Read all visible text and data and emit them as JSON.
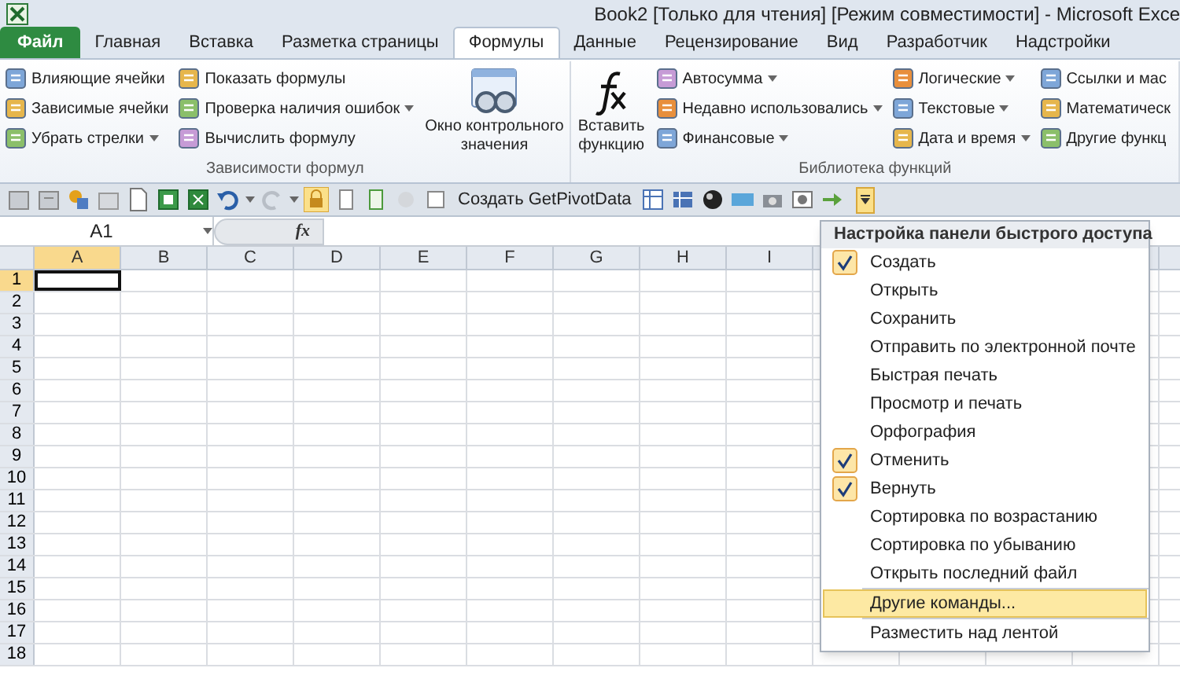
{
  "window": {
    "title": "Book2  [Только для чтения]  [Режим совместимости]  -  Microsoft Exce"
  },
  "tabs": [
    {
      "label": "Файл",
      "kind": "file",
      "selected": false
    },
    {
      "label": "Главная",
      "kind": "tab",
      "selected": false
    },
    {
      "label": "Вставка",
      "kind": "tab",
      "selected": false
    },
    {
      "label": "Разметка страницы",
      "kind": "tab",
      "selected": false
    },
    {
      "label": "Формулы",
      "kind": "tab",
      "selected": true
    },
    {
      "label": "Данные",
      "kind": "tab",
      "selected": false
    },
    {
      "label": "Рецензирование",
      "kind": "tab",
      "selected": false
    },
    {
      "label": "Вид",
      "kind": "tab",
      "selected": false
    },
    {
      "label": "Разработчик",
      "kind": "tab",
      "selected": false
    },
    {
      "label": "Надстройки",
      "kind": "tab",
      "selected": false
    }
  ],
  "ribbon": {
    "groups": [
      {
        "label": "Зависимости формул",
        "columns": [
          {
            "kind": "small",
            "items": [
              {
                "label": "Влияющие ячейки",
                "dropdown": false
              },
              {
                "label": "Зависимые ячейки",
                "dropdown": false
              },
              {
                "label": "Убрать стрелки",
                "dropdown": true
              }
            ]
          },
          {
            "kind": "small",
            "items": [
              {
                "label": "Показать формулы",
                "dropdown": false
              },
              {
                "label": "Проверка наличия ошибок",
                "dropdown": true
              },
              {
                "label": "Вычислить формулу",
                "dropdown": false
              }
            ]
          },
          {
            "kind": "large",
            "lines": [
              "Окно контрольного",
              "значения"
            ]
          }
        ]
      },
      {
        "label": "Библиотека функций",
        "columns": [
          {
            "kind": "large",
            "lines": [
              "Вставить",
              "функцию"
            ]
          },
          {
            "kind": "small",
            "items": [
              {
                "label": "Автосумма",
                "dropdown": true
              },
              {
                "label": "Недавно использовались",
                "dropdown": true
              },
              {
                "label": "Финансовые",
                "dropdown": true
              }
            ]
          },
          {
            "kind": "small",
            "items": [
              {
                "label": "Логические",
                "dropdown": true
              },
              {
                "label": "Текстовые",
                "dropdown": true
              },
              {
                "label": "Дата и время",
                "dropdown": true
              }
            ]
          },
          {
            "kind": "small",
            "items": [
              {
                "label": "Ссылки и мас",
                "dropdown": false
              },
              {
                "label": "Математическ",
                "dropdown": false
              },
              {
                "label": "Другие функц",
                "dropdown": false
              }
            ]
          }
        ]
      }
    ]
  },
  "quick_access": {
    "pivot_label": "Создать GetPivotData"
  },
  "formula_bar": {
    "name_box": "A1",
    "fx": "fx"
  },
  "grid": {
    "columns": [
      {
        "label": "A",
        "selected": true
      },
      {
        "label": "B",
        "selected": false
      },
      {
        "label": "C",
        "selected": false
      },
      {
        "label": "D",
        "selected": false
      },
      {
        "label": "E",
        "selected": false
      },
      {
        "label": "F",
        "selected": false
      },
      {
        "label": "G",
        "selected": false
      },
      {
        "label": "H",
        "selected": false
      },
      {
        "label": "I",
        "selected": false
      }
    ],
    "rows": [
      {
        "label": "1",
        "selected": true
      },
      {
        "label": "2",
        "selected": false
      },
      {
        "label": "3",
        "selected": false
      },
      {
        "label": "4",
        "selected": false
      },
      {
        "label": "5",
        "selected": false
      },
      {
        "label": "6",
        "selected": false
      },
      {
        "label": "7",
        "selected": false
      },
      {
        "label": "8",
        "selected": false
      },
      {
        "label": "9",
        "selected": false
      },
      {
        "label": "10",
        "selected": false
      },
      {
        "label": "11",
        "selected": false
      },
      {
        "label": "12",
        "selected": false
      },
      {
        "label": "13",
        "selected": false
      },
      {
        "label": "14",
        "selected": false
      },
      {
        "label": "15",
        "selected": false
      },
      {
        "label": "16",
        "selected": false
      },
      {
        "label": "17",
        "selected": false
      },
      {
        "label": "18",
        "selected": false
      }
    ]
  },
  "menu": {
    "title": "Настройка панели быстрого доступа",
    "items": [
      {
        "label": "Создать",
        "checked": true,
        "selected": false
      },
      {
        "label": "Открыть",
        "checked": false,
        "selected": false
      },
      {
        "label": "Сохранить",
        "checked": false,
        "selected": false
      },
      {
        "label": "Отправить по электронной почте",
        "checked": false,
        "selected": false
      },
      {
        "label": "Быстрая печать",
        "checked": false,
        "selected": false
      },
      {
        "label": "Просмотр и печать",
        "checked": false,
        "selected": false
      },
      {
        "label": "Орфография",
        "checked": false,
        "selected": false
      },
      {
        "label": "Отменить",
        "checked": true,
        "selected": false
      },
      {
        "label": "Вернуть",
        "checked": true,
        "selected": false
      },
      {
        "label": "Сортировка по возрастанию",
        "checked": false,
        "selected": false
      },
      {
        "label": "Сортировка по убыванию",
        "checked": false,
        "selected": false
      },
      {
        "label": "Открыть последний файл",
        "checked": false,
        "selected": false
      },
      {
        "label": "Другие команды...",
        "checked": false,
        "selected": true,
        "separator_before": true
      },
      {
        "label": "Разместить над лентой",
        "checked": false,
        "selected": false,
        "separator_before": true
      }
    ]
  }
}
